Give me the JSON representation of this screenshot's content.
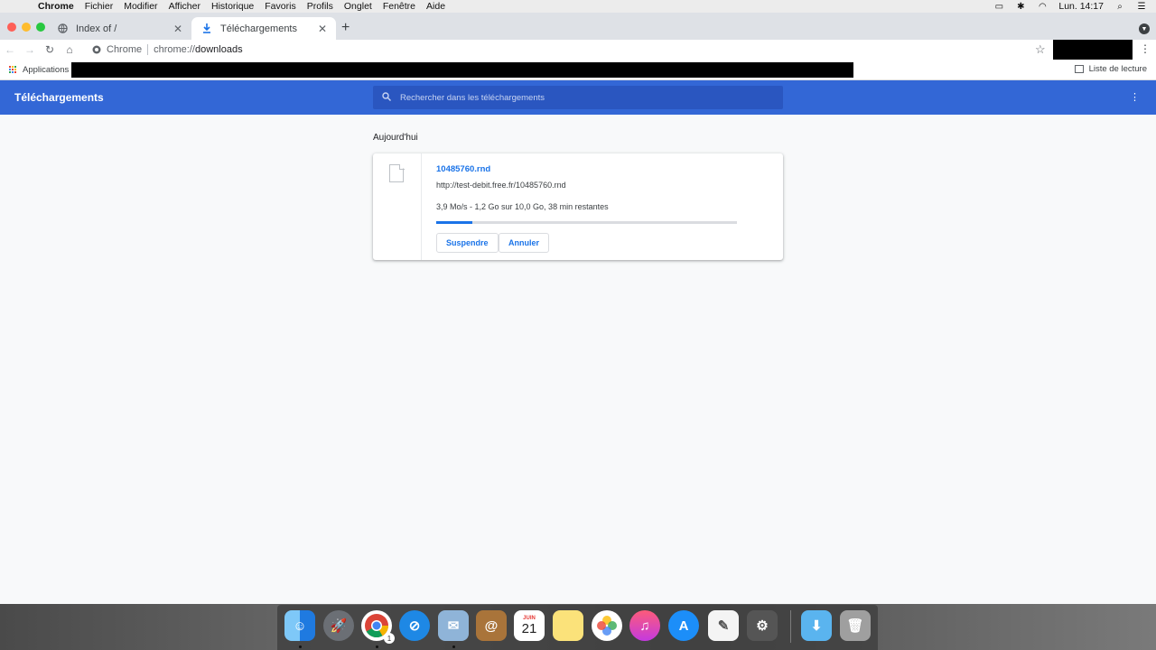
{
  "menubar": {
    "apple_icon": "apple-icon",
    "app_name": "Chrome",
    "items": [
      "Fichier",
      "Modifier",
      "Afficher",
      "Historique",
      "Favoris",
      "Profils",
      "Onglet",
      "Fenêtre",
      "Aide"
    ],
    "clock": "Lun. 14:17"
  },
  "tabs": [
    {
      "title": "Index of /",
      "icon": "globe-icon"
    },
    {
      "title": "Téléchargements",
      "icon": "download-icon"
    }
  ],
  "omnibox": {
    "chip_label": "Chrome",
    "url_scheme": "chrome://",
    "url_rest": "downloads"
  },
  "bookmarks": {
    "apps_label": "Applications",
    "reading_list_label": "Liste de lecture"
  },
  "downloads_page": {
    "title": "Téléchargements",
    "search_placeholder": "Rechercher dans les téléchargements",
    "section_date": "Aujourd'hui",
    "item": {
      "file_name": "10485760.rnd",
      "url": "http://test-debit.free.fr/10485760.rnd",
      "status": "3,9 Mo/s - 1,2 Go sur 10,0 Go, 38 min restantes",
      "progress_fraction": 0.12,
      "pause_label": "Suspendre",
      "cancel_label": "Annuler"
    }
  },
  "dock": {
    "calendar_month": "JUIN",
    "calendar_day": "21",
    "chrome_badge": "1",
    "apps": [
      "finder-icon",
      "launchpad-icon",
      "chrome-icon",
      "safari-icon",
      "mail-icon",
      "contacts-icon",
      "calendar-icon",
      "notes-icon",
      "photos-icon",
      "music-icon",
      "app-store-icon",
      "textedit-icon",
      "system-preferences-icon",
      "downloads-folder-icon",
      "trash-icon"
    ]
  },
  "colors": {
    "header_blue": "#3367d6",
    "link_blue": "#1a73e8",
    "page_bg": "#f8f9fa"
  }
}
